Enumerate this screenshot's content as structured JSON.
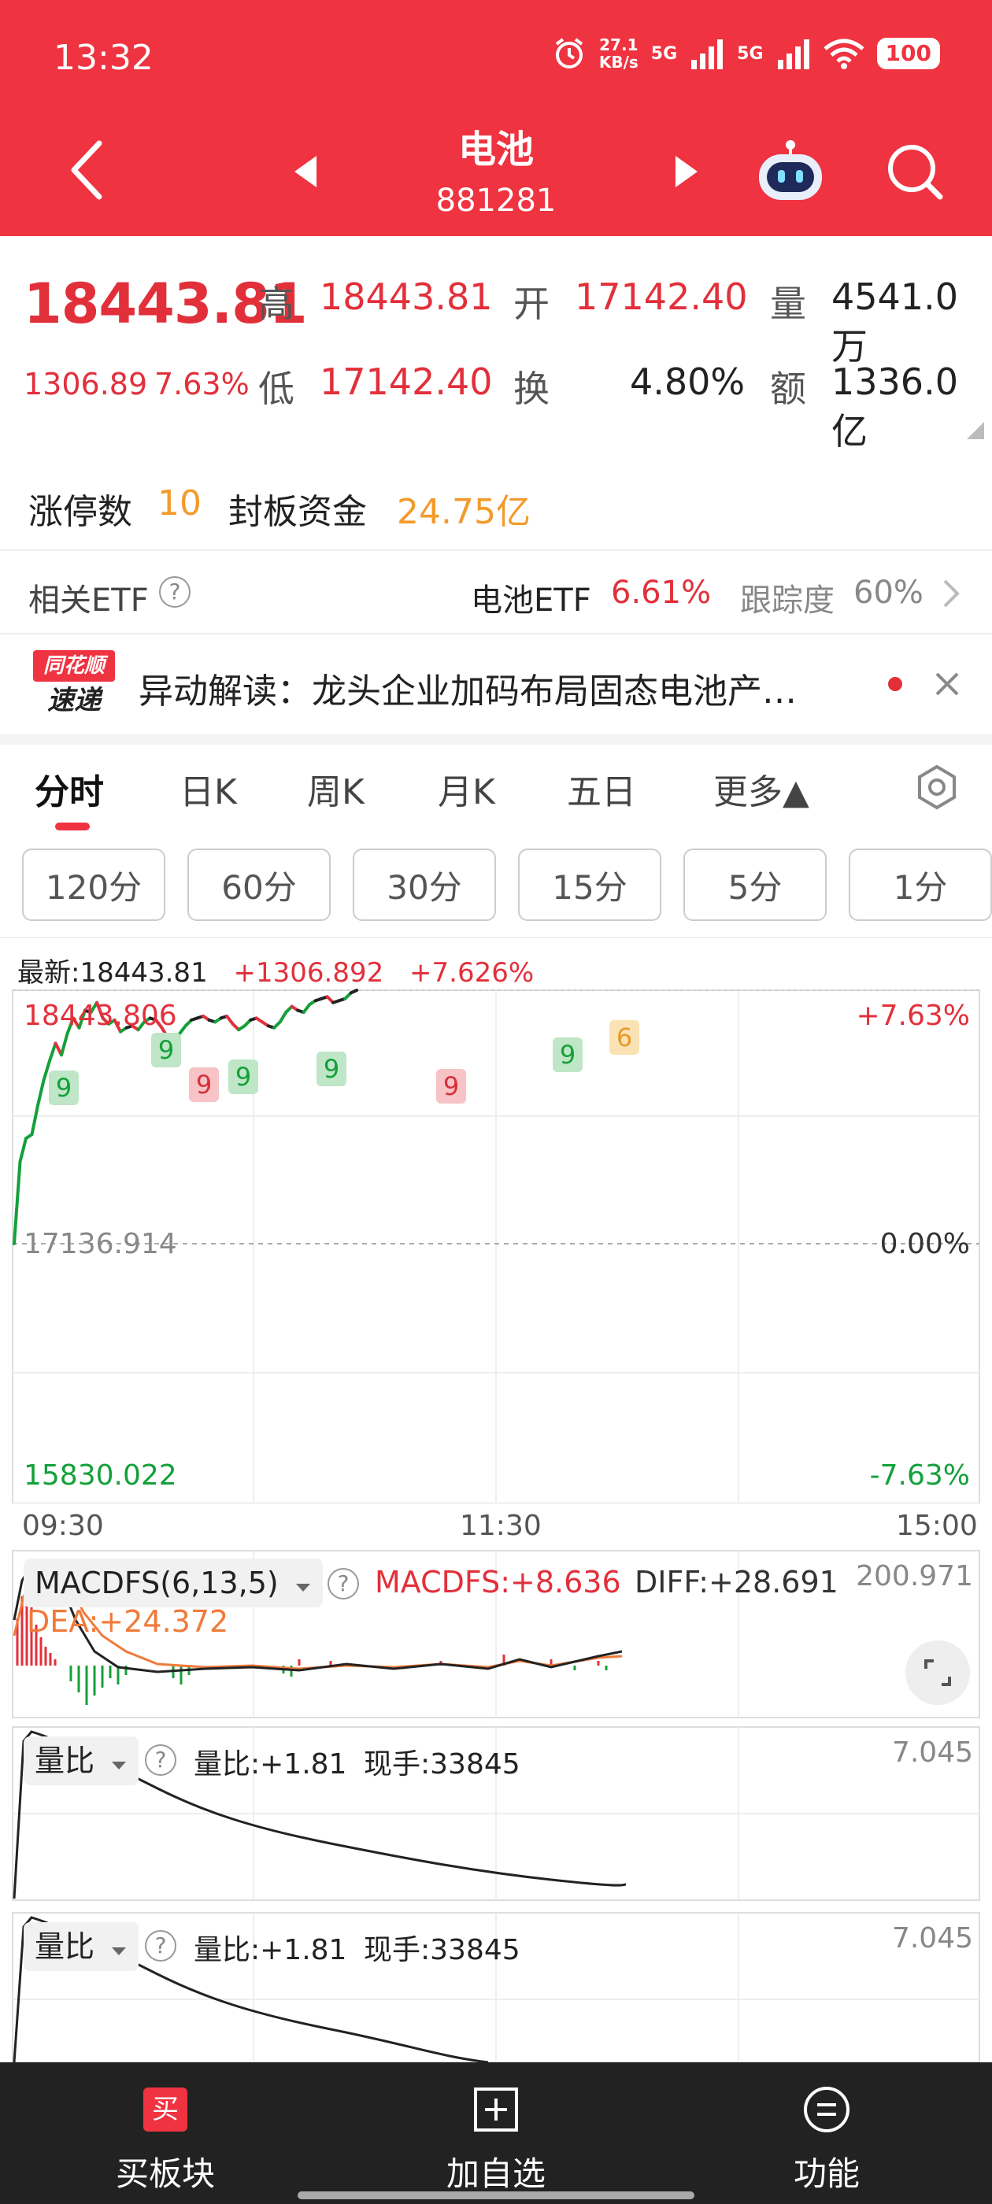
{
  "status": {
    "time": "13:32",
    "net_speed_value": "27.1",
    "net_speed_unit": "KB/s",
    "sig1": "5G",
    "sig2": "5G",
    "battery": "100"
  },
  "header": {
    "title": "电池",
    "code": "881281"
  },
  "quote": {
    "price": "18443.81",
    "change": "1306.89",
    "change_pct": "7.63%",
    "high_label": "高",
    "high": "18443.81",
    "open_label": "开",
    "open": "17142.40",
    "volume_label": "量",
    "volume": "4541.0万",
    "low_label": "低",
    "low": "17142.40",
    "turnover_label": "换",
    "turnover": "4.80%",
    "amount_label": "额",
    "amount": "1336.0亿"
  },
  "limit": {
    "count_label": "涨停数",
    "count": "10",
    "fund_label": "封板资金",
    "fund": "24.75亿"
  },
  "etf": {
    "label": "相关ETF",
    "name": "电池ETF",
    "pct": "6.61%",
    "track_label": "跟踪度",
    "track": "60%"
  },
  "news": {
    "logo_top": "同花顺",
    "logo_bottom": "速递",
    "text": "异动解读：龙头企业加码布局固态电池产…"
  },
  "tabs": [
    "分时",
    "日K",
    "周K",
    "月K",
    "五日",
    "更多▲"
  ],
  "minutes": [
    "120分",
    "60分",
    "30分",
    "15分",
    "5分",
    "1分"
  ],
  "chart_head": {
    "latest_label": "最新:",
    "latest": "18443.81",
    "change": "+1306.892",
    "pct": "+7.626%"
  },
  "chart_data": {
    "type": "line",
    "x_ticks": [
      "09:30",
      "11:30",
      "15:00"
    ],
    "y_left_ticks": [
      "18443.806",
      "17136.914",
      "15830.022"
    ],
    "y_right_ticks": [
      "+7.63%",
      "0.00%",
      "-7.63%"
    ],
    "ylim": [
      15830.022,
      18443.806
    ],
    "badges": [
      "9",
      "9",
      "9",
      "9",
      "9",
      "9",
      "9",
      "6"
    ],
    "series": [
      {
        "values": [
          17136.9,
          17560,
          17680,
          17700,
          17850,
          17980,
          18080,
          18170,
          18110,
          18220,
          18300,
          18250,
          18340,
          18330,
          18380,
          18300,
          18270,
          18290,
          18230,
          18250,
          18260,
          18240,
          18280,
          18300,
          18290,
          18250,
          18200,
          18180,
          18220,
          18260,
          18290,
          18300,
          18310,
          18290,
          18280,
          18300,
          18310,
          18270,
          18240,
          18260,
          18290,
          18300,
          18280,
          18260,
          18250,
          18280,
          18330,
          18360,
          18340,
          18330,
          18370,
          18390,
          18400,
          18410,
          18380,
          18390,
          18400,
          18430,
          18443.8
        ]
      }
    ]
  },
  "macd": {
    "name": "MACDFS(6,13,5)",
    "macdfs": "MACDFS:+8.636",
    "diff": "DIFF:+28.691",
    "dea": "DEA:+24.372",
    "max": "200.971"
  },
  "vr1": {
    "name": "量比",
    "value": "量比:+1.81",
    "hand": "现手:33845",
    "max": "7.045"
  },
  "vr2": {
    "name": "量比",
    "value": "量比:+1.81",
    "hand": "现手:33845",
    "max": "7.045"
  },
  "nav": [
    {
      "label": "买板块",
      "icon": "买"
    },
    {
      "label": "加自选"
    },
    {
      "label": "功能"
    }
  ],
  "colors": {
    "brand": "#ef3340",
    "up": "#e2303b",
    "down": "#14a03a",
    "accent": "#f39a2c"
  }
}
